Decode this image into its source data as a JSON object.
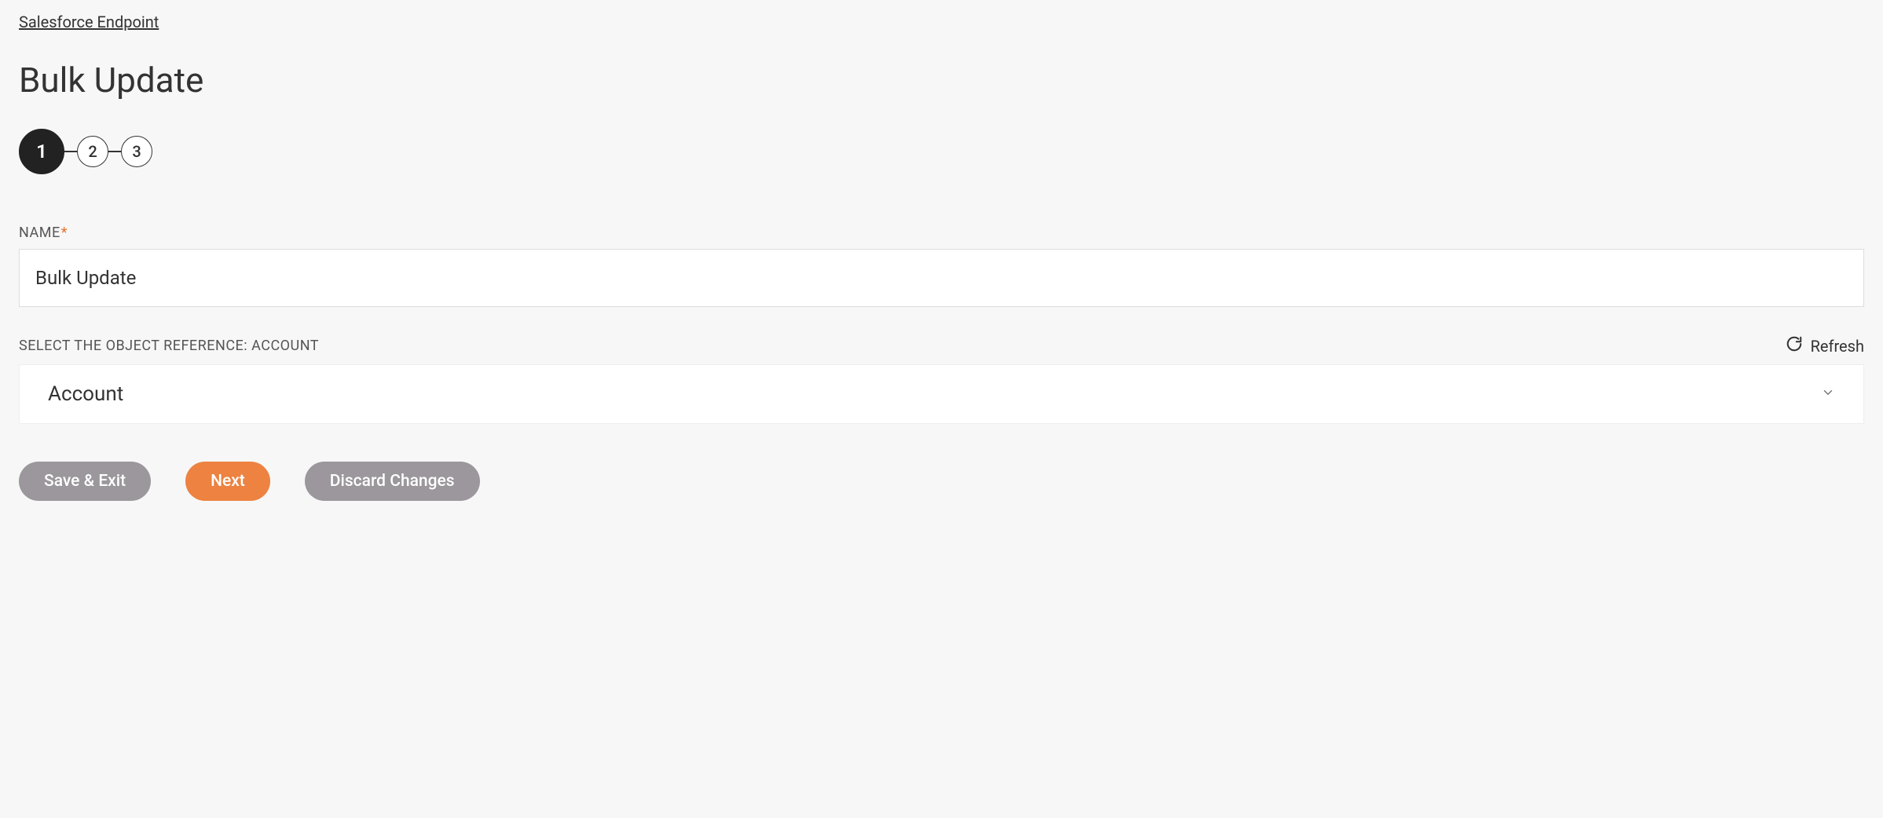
{
  "breadcrumb": "Salesforce Endpoint",
  "title": "Bulk Update",
  "stepper": {
    "steps": [
      "1",
      "2",
      "3"
    ],
    "active_index": 0
  },
  "form": {
    "name": {
      "label": "NAME",
      "required_marker": "*",
      "value": "Bulk Update"
    },
    "object_ref": {
      "label": "SELECT THE OBJECT REFERENCE: ACCOUNT",
      "refresh_label": "Refresh",
      "selected": "Account"
    }
  },
  "buttons": {
    "save_exit": "Save & Exit",
    "next": "Next",
    "discard": "Discard Changes"
  }
}
